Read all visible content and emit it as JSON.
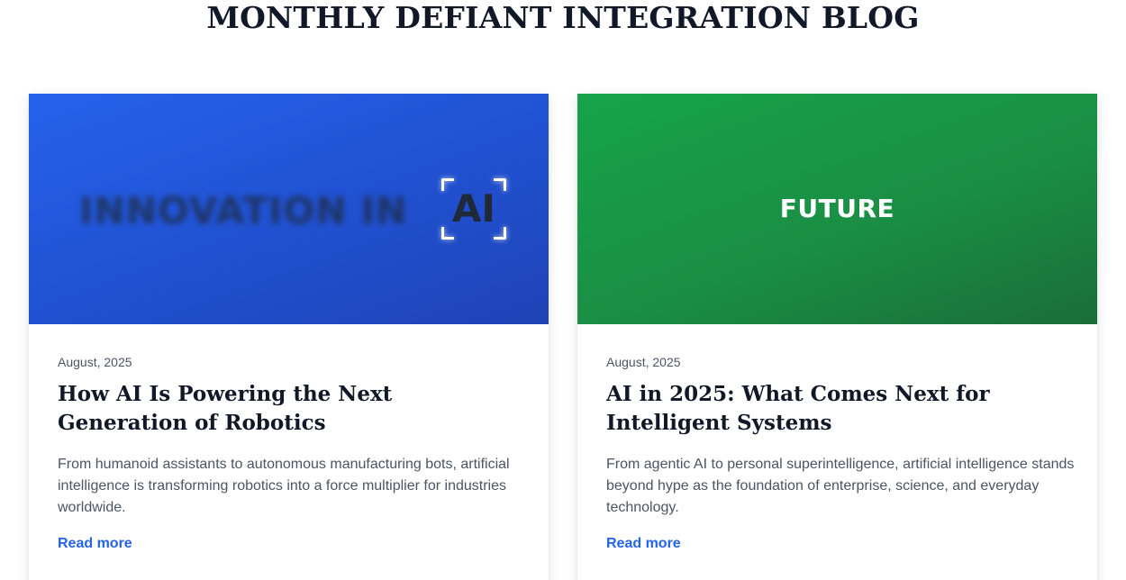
{
  "page": {
    "title": "MONTHLY DEFIANT INTEGRATION BLOG"
  },
  "colors": {
    "title_text": "#111827",
    "accent_link": "#2563eb",
    "blue_image": "#2563eb",
    "green_image": "#16a34a"
  },
  "posts": [
    {
      "image_text": "INNOVATION IN",
      "image_highlight": "AI",
      "date": "August, 2025",
      "title": "How AI Is Powering the Next Generation of Robotics",
      "excerpt": "From humanoid assistants to autonomous manufacturing bots, artificial intelligence is transforming robotics into a force multiplier for industries worldwide.",
      "link_label": "Read more"
    },
    {
      "image_text": "FUTURE",
      "date": "August, 2025",
      "title": "AI in 2025: What Comes Next for Intelligent Systems",
      "excerpt": "From agentic AI to personal superintelligence, artificial intelligence stands beyond hype as the foundation of enterprise, science, and everyday technology.",
      "link_label": "Read more"
    }
  ]
}
